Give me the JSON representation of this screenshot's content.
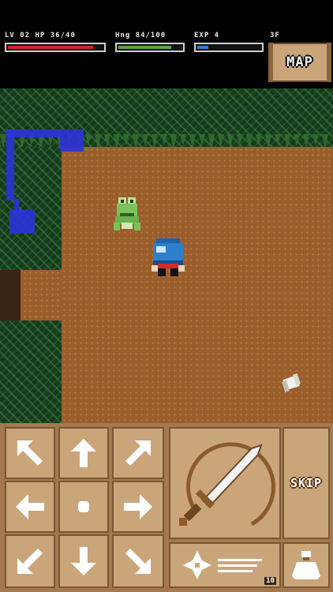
{
  "hud": {
    "level_hp_label": "LV 02 HP 36/40",
    "hunger_label": "Hng 84/100",
    "exp_label": "EXP 4",
    "floor_label": "3F",
    "hp": {
      "current": 36,
      "max": 40,
      "color": "#d8222a"
    },
    "hunger": {
      "current": 84,
      "max": 100,
      "color": "#5aa83e"
    },
    "exp": {
      "fraction": 0.18,
      "color": "#2b7fd8"
    },
    "map_button_label": "MAP"
  },
  "controls": {
    "skip_label": "SKIP",
    "item_count": "10",
    "colors": {
      "panel": "#a5794f",
      "button": "#caa57a",
      "border": "#7a5633",
      "icon": "#ffffff"
    }
  },
  "field": {
    "colors": {
      "floor": "#9a5d2c",
      "grass": "#17391e",
      "minimap": "#2a33d6"
    },
    "entities": [
      "frog-enemy",
      "player-hero",
      "scroll-item"
    ]
  }
}
